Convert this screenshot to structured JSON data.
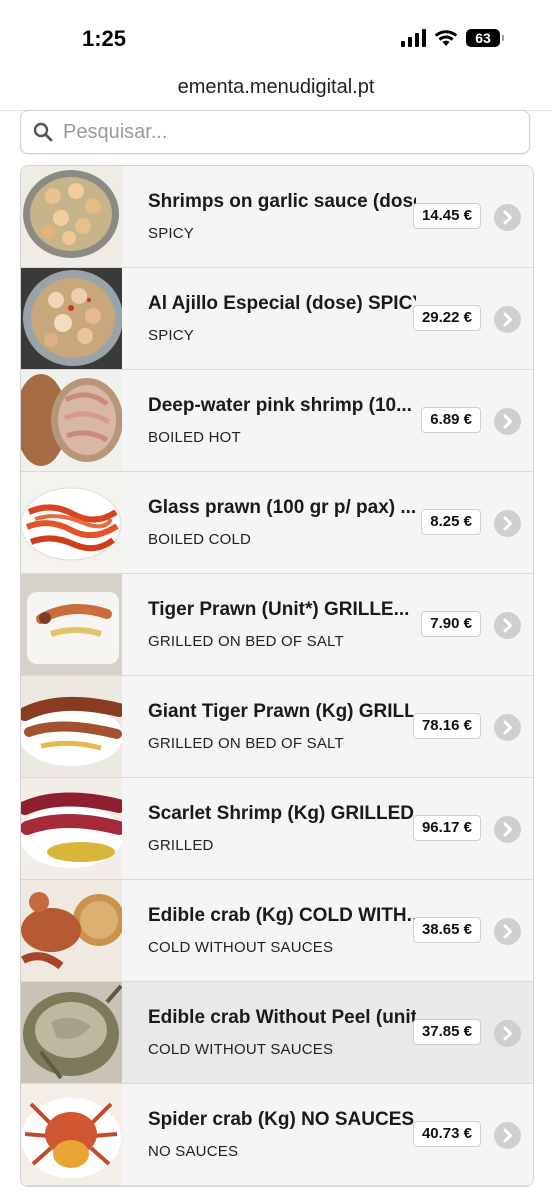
{
  "status": {
    "time": "1:25",
    "battery": "63"
  },
  "browser": {
    "url": "ementa.menudigital.pt"
  },
  "search": {
    "placeholder": "Pesquisar..."
  },
  "items": [
    {
      "name": "Shrimps on garlic sauce (dose)",
      "desc": "SPICY",
      "price": "14.45 €",
      "thumb": "shrimp-garlic"
    },
    {
      "name": "Al Ajillo Especial (dose) SPICY",
      "desc": "SPICY",
      "price": "29.22 €",
      "thumb": "al-ajillo"
    },
    {
      "name": "Deep-water pink shrimp (10...",
      "desc": "BOILED HOT",
      "price": "6.89 €",
      "thumb": "pink-shrimp"
    },
    {
      "name": "Glass prawn (100 gr p/ pax) ...",
      "desc": "BOILED COLD",
      "price": "8.25 €",
      "thumb": "glass-prawn"
    },
    {
      "name": "Tiger Prawn (Unit*) GRILLE...",
      "desc": "GRILLED ON BED OF SALT",
      "price": "7.90 €",
      "thumb": "tiger-prawn"
    },
    {
      "name": "Giant Tiger Prawn (Kg) GRILLED",
      "desc": "GRILLED ON BED OF SALT",
      "price": "78.16 €",
      "thumb": "giant-tiger-prawn"
    },
    {
      "name": "Scarlet Shrimp (Kg) GRILLED",
      "desc": "GRILLED",
      "price": "96.17 €",
      "thumb": "scarlet-shrimp"
    },
    {
      "name": "Edible crab (Kg) COLD WITH...",
      "desc": "COLD WITHOUT SAUCES",
      "price": "38.65 €",
      "thumb": "edible-crab"
    },
    {
      "name": "Edible crab Without Peel (unit)",
      "desc": "COLD WITHOUT SAUCES",
      "price": "37.85 €",
      "thumb": "edible-crab-no-peel"
    },
    {
      "name": "Spider crab (Kg) NO SAUCES",
      "desc": "NO SAUCES",
      "price": "40.73 €",
      "thumb": "spider-crab"
    }
  ],
  "colors": {
    "chevron": "#cfcfcf",
    "active_row": "#e9e9e9",
    "row": "#f5f5f5"
  }
}
